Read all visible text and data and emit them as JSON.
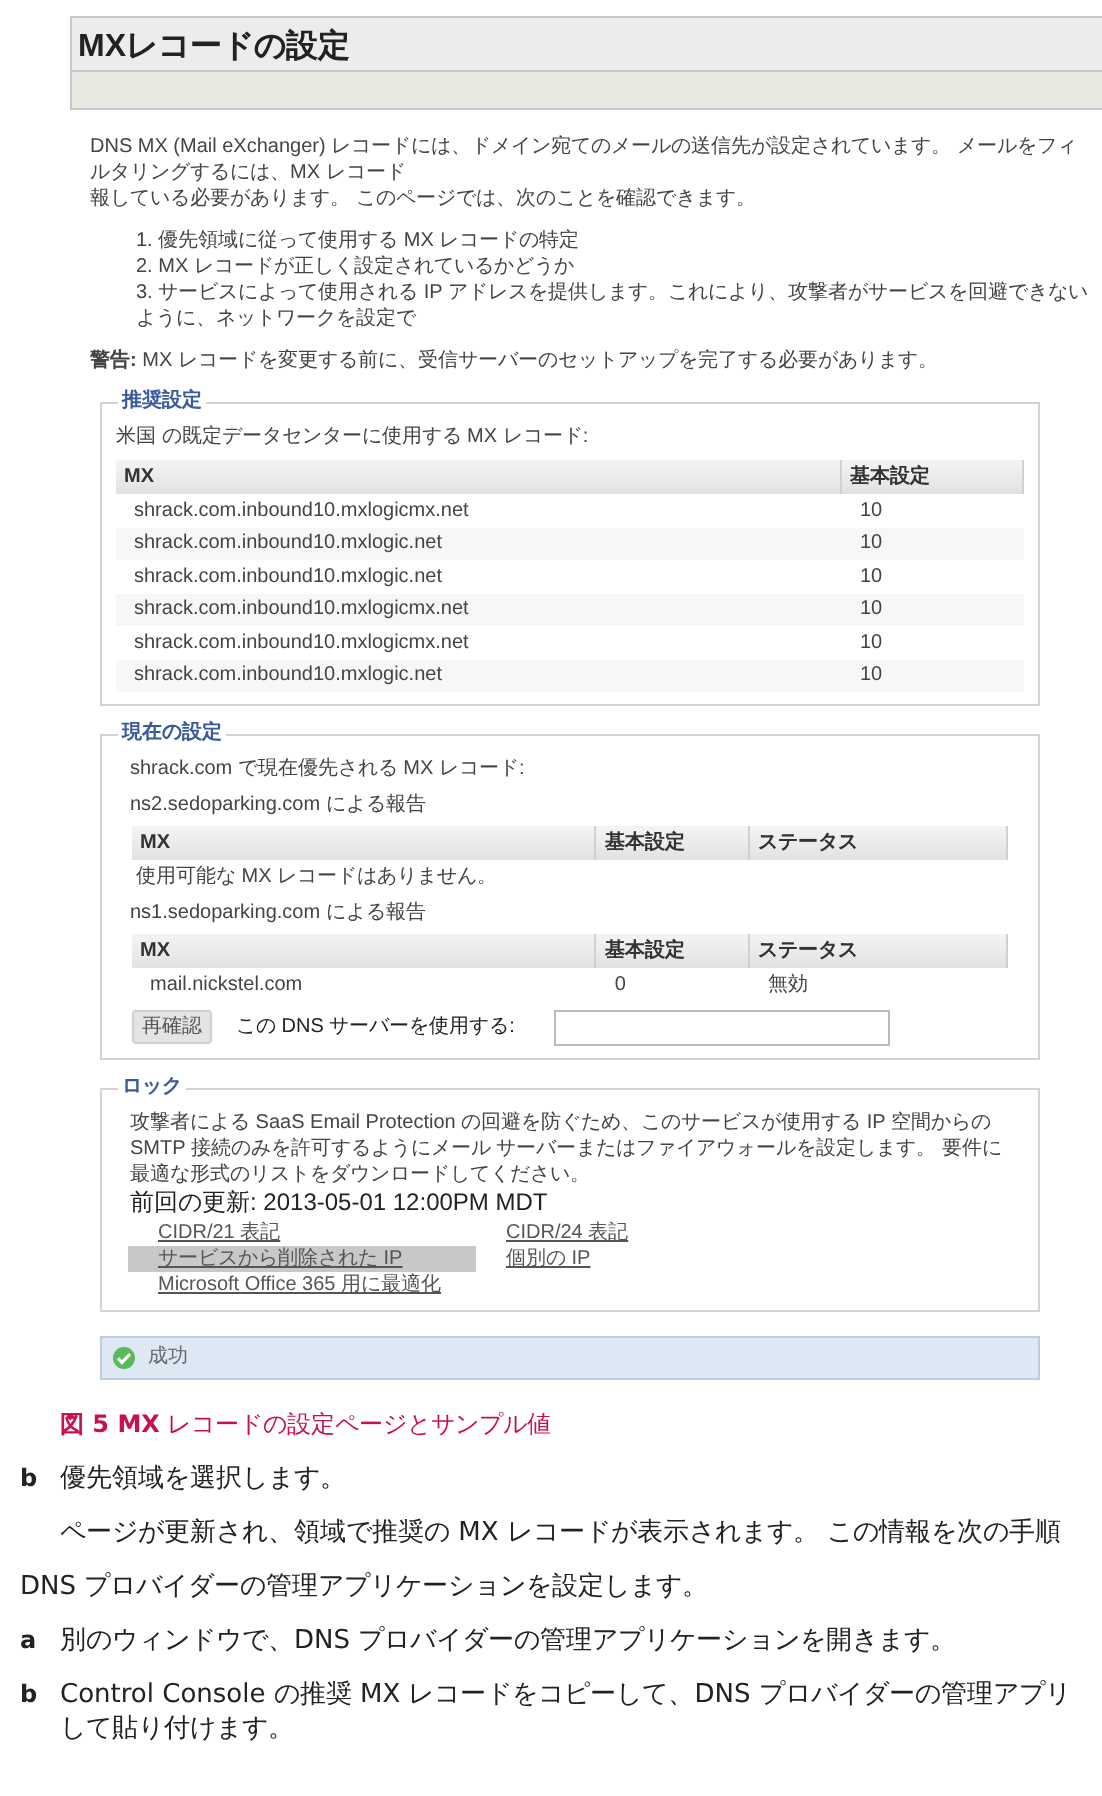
{
  "header": {
    "title": "MXレコードの設定"
  },
  "intro": {
    "lines": [
      "DNS MX (Mail eXchanger) レコードには、ドメイン宛てのメールの送信先が設定されています。 メールをフィルタリングするには、MX レコード",
      "報している必要があります。 このページでは、次のことを確認できます。"
    ]
  },
  "checklist": [
    "1. 優先領域に従って使用する MX レコードの特定",
    "2. MX レコードが正しく設定されているかどうか",
    "3. サービスによって使用される IP アドレスを提供します。これにより、攻撃者がサービスを回避できないように、ネットワークを設定で"
  ],
  "warning": "**警告:** MX レコードを変更する前に、受信サーバーのセットアップを完了する必要があります。",
  "recommended": {
    "legend": "推奨設定",
    "caption": "米国 の既定データセンターに使用する MX レコード:",
    "columns": [
      "MX",
      "基本設定"
    ],
    "rows": [
      [
        "shrack.com.inbound10.mxlogicmx.net",
        "10"
      ],
      [
        "shrack.com.inbound10.mxlogic.net",
        "10"
      ],
      [
        "shrack.com.inbound10.mxlogic.net",
        "10"
      ],
      [
        "shrack.com.inbound10.mxlogicmx.net",
        "10"
      ],
      [
        "shrack.com.inbound10.mxlogicmx.net",
        "10"
      ],
      [
        "shrack.com.inbound10.mxlogic.net",
        "10"
      ]
    ]
  },
  "current": {
    "legend": "現在の設定",
    "caption": "shrack.com で現在優先される MX レコード:",
    "reports": [
      {
        "source": "ns2.sedoparking.com による報告",
        "columns": [
          "MX",
          "基本設定",
          "ステータス"
        ],
        "empty_message": "使用可能な MX レコードはありません。"
      },
      {
        "source": "ns1.sedoparking.com による報告",
        "columns": [
          "MX",
          "基本設定",
          "ステータス"
        ],
        "rows": [
          [
            "mail.nickstel.com",
            "0",
            "無効"
          ]
        ]
      }
    ],
    "recheck_button": "再確認",
    "dns_label": "この DNS サーバーを使用する:"
  },
  "lock": {
    "legend": "ロック",
    "description": "攻撃者による SaaS Email Protection の回避を防ぐため、このサービスが使用する IP 空間からの SMTP 接続のみを許可するようにメール サーバーまたはファイアウォールを設定します。 要件に最適な形式のリストをダウンロードしてください。",
    "last_update": "前回の更新: 2013-05-01 12:00PM MDT",
    "links": [
      {
        "label": "CIDR/21 表記",
        "highlighted": false
      },
      {
        "label": "CIDR/24 表記",
        "highlighted": false
      },
      {
        "label": "サービスから削除された IP",
        "highlighted": true
      },
      {
        "label": "個別の IP",
        "highlighted": false
      },
      {
        "label": "Microsoft Office 365 用に最適化",
        "highlighted": false
      }
    ]
  },
  "status": {
    "kind": "success",
    "text": "成功"
  },
  "figure_caption": "**図 5  MX** レコードの設定ページとサンプル値",
  "steps": [
    {
      "kind": "substep",
      "marker": "b",
      "lines": [
        "優先領域を選択します。"
      ]
    },
    {
      "kind": "note",
      "lines": [
        "ページが更新され、領域で推奨の MX レコードが表示されます。 この情報を次の手順"
      ]
    },
    {
      "kind": "step",
      "lines": [
        "DNS プロバイダーの管理アプリケーションを設定します。"
      ]
    },
    {
      "kind": "substep",
      "marker": "a",
      "lines": [
        "別のウィンドウで、DNS プロバイダーの管理アプリケーションを開きます。"
      ]
    },
    {
      "kind": "substep",
      "marker": "b",
      "lines": [
        "Control Console の推奨 MX レコードをコピーして、DNS プロバイダーの管理アプリ",
        "して貼り付けます。"
      ]
    }
  ]
}
